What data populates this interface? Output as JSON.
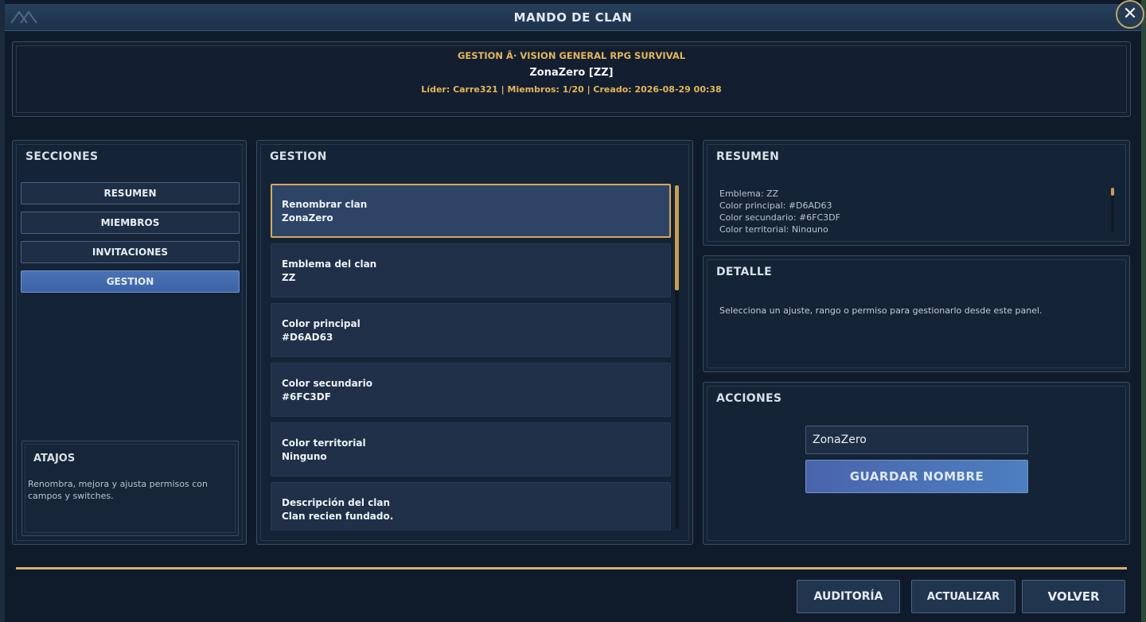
{
  "window": {
    "title": "MANDO DE CLAN",
    "close_symbol": "✕"
  },
  "header": {
    "subtitle": "GESTION Â· VISION GENERAL RPG SURVIVAL",
    "clan_name": "ZonaZero [ZZ]",
    "meta": "Líder: Carre321 | Miembros: 1/20 | Creado: 2026-08-29 00:38"
  },
  "sections": {
    "title": "SECCIONES",
    "items": [
      {
        "label": "RESUMEN",
        "active": false
      },
      {
        "label": "MIEMBROS",
        "active": false
      },
      {
        "label": "INVITACIONES",
        "active": false
      },
      {
        "label": "GESTION",
        "active": true
      }
    ]
  },
  "shortcuts": {
    "title": "ATAJOS",
    "text": "Renombra, mejora y ajusta permisos con campos y switches."
  },
  "gestion": {
    "title": "GESTION",
    "items": [
      {
        "label": "Renombrar clan",
        "value": "ZonaZero",
        "selected": true
      },
      {
        "label": "Emblema del clan",
        "value": "ZZ",
        "selected": false
      },
      {
        "label": "Color principal",
        "value": "#D6AD63",
        "selected": false
      },
      {
        "label": "Color secundario",
        "value": "#6FC3DF",
        "selected": false
      },
      {
        "label": "Color territorial",
        "value": "Ninguno",
        "selected": false
      },
      {
        "label": "Descripción del clan",
        "value": "Clan recien fundado.",
        "selected": false
      }
    ]
  },
  "resumen": {
    "title": "RESUMEN",
    "lines": [
      "Emblema: ZZ",
      "Color principal: #D6AD63",
      "Color secundario: #6FC3DF",
      "Color territorial: Ninguno"
    ]
  },
  "detalle": {
    "title": "DETALLE",
    "text": "Selecciona un ajuste, rango o permiso para gestionarlo desde este panel."
  },
  "acciones": {
    "title": "ACCIONES",
    "input_value": "ZonaZero",
    "save_label": "GUARDAR NOMBRE"
  },
  "footer": {
    "auditoria": "AUDITORÍA",
    "actualizar": "ACTUALIZAR",
    "volver": "VOLVER"
  },
  "colors": {
    "accent_gold": "#D8B068",
    "active_blue": "#4A72B4",
    "panel_bg": "#152336"
  }
}
